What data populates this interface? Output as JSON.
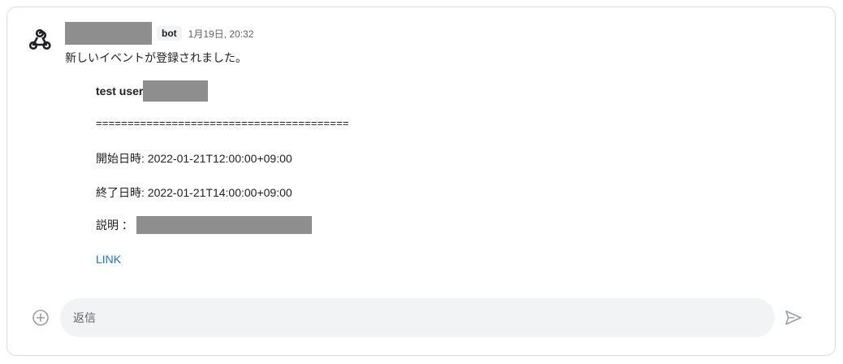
{
  "message": {
    "bot_badge": "bot",
    "timestamp": "1月19日, 20:32",
    "intro": "新しいイベントが登録されました。",
    "event_title_prefix": "test user",
    "separator": "========================================",
    "start": "開始日時: 2022-01-21T12:00:00+09:00",
    "end": "終了日時: 2022-01-21T14:00:00+09:00",
    "description_label": "説明 ：",
    "link_label": "LINK"
  },
  "reply": {
    "placeholder": "返信"
  },
  "icons": {
    "avatar": "webhook-icon",
    "add": "add-circle-icon",
    "send": "send-icon"
  }
}
